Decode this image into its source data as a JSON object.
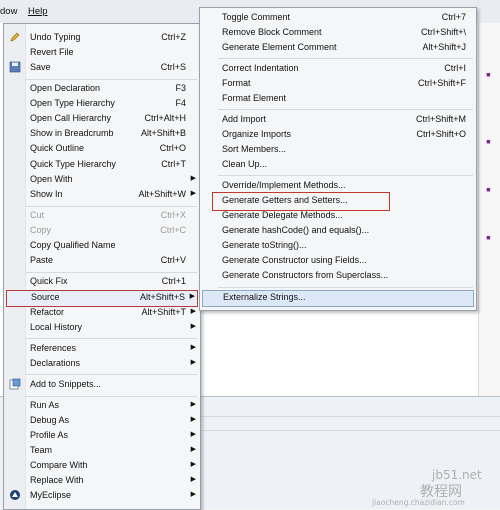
{
  "menubar": {
    "window_label": "dow",
    "help_label": "Help"
  },
  "context_menu": {
    "items": [
      {
        "label": "Undo Typing",
        "shortcut": "Ctrl+Z"
      },
      {
        "label": "Revert File",
        "shortcut": ""
      },
      {
        "label": "Save",
        "shortcut": "Ctrl+S"
      },
      {
        "label": "Open Declaration",
        "shortcut": "F3"
      },
      {
        "label": "Open Type Hierarchy",
        "shortcut": "F4"
      },
      {
        "label": "Open Call Hierarchy",
        "shortcut": "Ctrl+Alt+H"
      },
      {
        "label": "Show in Breadcrumb",
        "shortcut": "Alt+Shift+B"
      },
      {
        "label": "Quick Outline",
        "shortcut": "Ctrl+O"
      },
      {
        "label": "Quick Type Hierarchy",
        "shortcut": "Ctrl+T"
      },
      {
        "label": "Open With",
        "shortcut": ""
      },
      {
        "label": "Show In",
        "shortcut": "Alt+Shift+W"
      },
      {
        "label": "Cut",
        "shortcut": "Ctrl+X"
      },
      {
        "label": "Copy",
        "shortcut": "Ctrl+C"
      },
      {
        "label": "Copy Qualified Name",
        "shortcut": ""
      },
      {
        "label": "Paste",
        "shortcut": "Ctrl+V"
      },
      {
        "label": "Quick Fix",
        "shortcut": "Ctrl+1"
      },
      {
        "label": "Source",
        "shortcut": "Alt+Shift+S"
      },
      {
        "label": "Refactor",
        "shortcut": "Alt+Shift+T"
      },
      {
        "label": "Local History",
        "shortcut": ""
      },
      {
        "label": "References",
        "shortcut": ""
      },
      {
        "label": "Declarations",
        "shortcut": ""
      },
      {
        "label": "Add to Snippets...",
        "shortcut": ""
      },
      {
        "label": "Run As",
        "shortcut": ""
      },
      {
        "label": "Debug As",
        "shortcut": ""
      },
      {
        "label": "Profile As",
        "shortcut": ""
      },
      {
        "label": "Team",
        "shortcut": ""
      },
      {
        "label": "Compare With",
        "shortcut": ""
      },
      {
        "label": "Replace With",
        "shortcut": ""
      },
      {
        "label": "MyEclipse",
        "shortcut": ""
      }
    ]
  },
  "source_submenu": {
    "items": [
      {
        "label": "Toggle Comment",
        "shortcut": "Ctrl+7"
      },
      {
        "label": "Remove Block Comment",
        "shortcut": "Ctrl+Shift+\\"
      },
      {
        "label": "Generate Element Comment",
        "shortcut": "Alt+Shift+J"
      },
      {
        "label": "Correct Indentation",
        "shortcut": "Ctrl+I"
      },
      {
        "label": "Format",
        "shortcut": "Ctrl+Shift+F"
      },
      {
        "label": "Format Element",
        "shortcut": ""
      },
      {
        "label": "Add Import",
        "shortcut": "Ctrl+Shift+M"
      },
      {
        "label": "Organize Imports",
        "shortcut": "Ctrl+Shift+O"
      },
      {
        "label": "Sort Members...",
        "shortcut": ""
      },
      {
        "label": "Clean Up...",
        "shortcut": ""
      },
      {
        "label": "Override/Implement Methods...",
        "shortcut": ""
      },
      {
        "label": "Generate Getters and Setters...",
        "shortcut": ""
      },
      {
        "label": "Generate Delegate Methods...",
        "shortcut": ""
      },
      {
        "label": "Generate hashCode() and equals()...",
        "shortcut": ""
      },
      {
        "label": "Generate toString()...",
        "shortcut": ""
      },
      {
        "label": "Generate Constructor using Fields...",
        "shortcut": ""
      },
      {
        "label": "Generate Constructors from Superclass...",
        "shortcut": ""
      },
      {
        "label": "Externalize Strings...",
        "shortcut": ""
      }
    ]
  },
  "watermark": {
    "line1": "jb51.net",
    "line2": "教程网",
    "line3": "jiaocheng.chazidian.com"
  },
  "colors": {
    "highlight_border": "#b53a3a",
    "menu_bg": "#f5f6f7"
  }
}
